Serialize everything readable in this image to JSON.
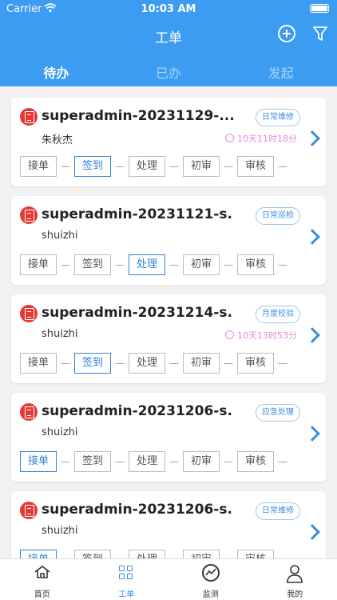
{
  "status_bar": {
    "carrier": "Carrier",
    "time": "10:03 AM"
  },
  "nav": {
    "title": "工单",
    "add_icon": "plus-circle-icon",
    "filter_icon": "filter-icon"
  },
  "tabs": [
    {
      "label": "待办",
      "active": true
    },
    {
      "label": "已办",
      "active": false
    },
    {
      "label": "发起",
      "active": false
    }
  ],
  "work_orders": [
    {
      "title": "superadmin-20231129-...",
      "assignee": "朱秋杰",
      "type": "日常维修",
      "timer": "10天11时18分",
      "steps": [
        {
          "label": "接单",
          "active": false
        },
        {
          "label": "签到",
          "active": true
        },
        {
          "label": "处理",
          "active": false
        },
        {
          "label": "初审",
          "active": false
        },
        {
          "label": "审核",
          "active": false
        }
      ]
    },
    {
      "title": "superadmin-20231121-s...",
      "assignee": "shuizhi",
      "type": "日常巡检",
      "timer": "",
      "steps": [
        {
          "label": "接单",
          "active": false
        },
        {
          "label": "签到",
          "active": false
        },
        {
          "label": "处理",
          "active": true
        },
        {
          "label": "初审",
          "active": false
        },
        {
          "label": "审核",
          "active": false
        }
      ]
    },
    {
      "title": "superadmin-20231214-s...",
      "assignee": "shuizhi",
      "type": "月度校验",
      "timer": "10天13时53分",
      "steps": [
        {
          "label": "接单",
          "active": false
        },
        {
          "label": "签到",
          "active": true
        },
        {
          "label": "处理",
          "active": false
        },
        {
          "label": "初审",
          "active": false
        },
        {
          "label": "审核",
          "active": false
        }
      ]
    },
    {
      "title": "superadmin-20231206-s...",
      "assignee": "shuizhi",
      "type": "应急处理",
      "timer": "",
      "steps": [
        {
          "label": "接单",
          "active": true
        },
        {
          "label": "签到",
          "active": false
        },
        {
          "label": "处理",
          "active": false
        },
        {
          "label": "初审",
          "active": false
        },
        {
          "label": "审核",
          "active": false
        }
      ]
    },
    {
      "title": "superadmin-20231206-s...",
      "assignee": "shuizhi",
      "type": "日常维修",
      "timer": "",
      "steps": [
        {
          "label": "接单",
          "active": true
        },
        {
          "label": "签到",
          "active": false
        },
        {
          "label": "处理",
          "active": false
        },
        {
          "label": "初审",
          "active": false
        },
        {
          "label": "审核",
          "active": false
        }
      ]
    }
  ],
  "bottom_tabs": [
    {
      "label": "首页",
      "icon": "home-icon",
      "active": false
    },
    {
      "label": "工单",
      "icon": "grid-icon",
      "active": true
    },
    {
      "label": "监测",
      "icon": "monitor-icon",
      "active": false
    },
    {
      "label": "我的",
      "icon": "user-icon",
      "active": false
    }
  ],
  "colors": {
    "primary": "#3b9cf2",
    "accent": "#3b8fd8",
    "timer": "#e28ad8",
    "doc_icon": "#e53935"
  }
}
